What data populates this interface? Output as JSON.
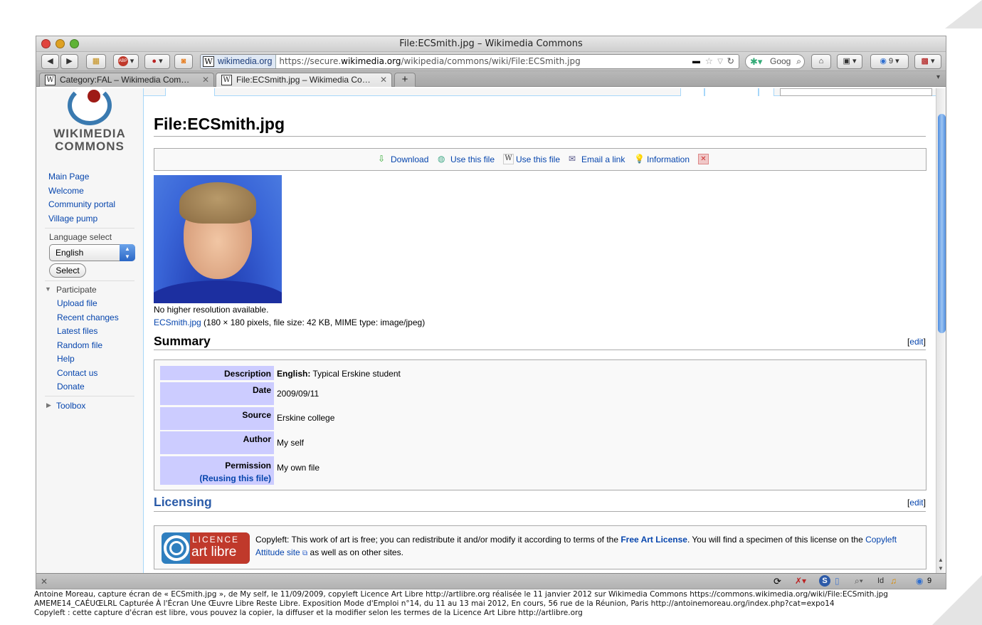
{
  "window": {
    "title": "File:ECSmith.jpg – Wikimedia Commons"
  },
  "navbar": {
    "site_badge": "wikimedia.org",
    "url_prefix": "https://secure.",
    "url_domain": "wikimedia.org",
    "url_path": "/wikipedia/commons/wiki/File:ECSmith.jpg",
    "search_placeholder": "Goog",
    "tab_count": "9"
  },
  "tabs": [
    {
      "label": "Category:FAL – Wikimedia Com…",
      "icon": "W"
    },
    {
      "label": "File:ECSmith.jpg – Wikimedia Co…",
      "icon": "W"
    }
  ],
  "sidebar": {
    "logo_line1": "WIKIMEDIA",
    "logo_line2": "COMMONS",
    "nav": [
      "Main Page",
      "Welcome",
      "Community portal",
      "Village pump"
    ],
    "language_heading": "Language select",
    "language_value": "English",
    "select_button": "Select",
    "participate_heading": "Participate",
    "participate": [
      "Upload file",
      "Recent changes",
      "Latest files",
      "Random file",
      "Help",
      "Contact us",
      "Donate"
    ],
    "toolbox_heading": "Toolbox"
  },
  "page": {
    "title": "File:ECSmith.jpg",
    "file_actions": [
      "Download",
      "Use this file",
      "Use this file",
      "Email a link",
      "Information"
    ],
    "no_higher_res": "No higher resolution available.",
    "file_link": "ECSmith.jpg",
    "file_meta": "(180 × 180 pixels, file size: 42 KB, MIME type: image/jpeg)",
    "summary_heading": "Summary",
    "edit_label": "edit",
    "info": {
      "description_label": "Description",
      "description_lang": "English:",
      "description_value": "Typical Erskine student",
      "date_label": "Date",
      "date_value": "2009/09/11",
      "source_label": "Source",
      "source_value": "Erskine college",
      "author_label": "Author",
      "author_value": "My self",
      "permission_label": "Permission",
      "permission_sub": "(Reusing this file)",
      "permission_value": "My own file"
    },
    "licensing_heading": "Licensing",
    "license_logo_top": "LICENCE",
    "license_logo_bottom": "art libre",
    "license_text_1": "Copyleft: This work of art is free; you can redistribute it and/or modify it according to terms of the ",
    "license_link_1": "Free Art License",
    "license_text_2": ". You will find a specimen of this license on the ",
    "license_link_2": "Copyleft Attitude site",
    "license_text_3": " as well as on other sites."
  },
  "statusbar": {
    "badge_count": "9",
    "id_label": "Id"
  },
  "caption": {
    "line1": "Antoine Moreau, capture écran de « ECSmith.jpg », de My self, le 11/09/2009, copyleft Licence Art Libre http://artlibre.org réalisée le 11 janvier 2012 sur Wikimedia Commons https://commons.wikimedia.org/wiki/File:ECSmith.jpg",
    "line2": "AMEME14_CAÉUŒLRL Capturée À l'Écran Une Œuvre Libre Reste Libre. Exposition Mode d'Emploi n°14, du 11 au 13 mai 2012, En cours, 56 rue de la Réunion, Paris http://antoinemoreau.org/index.php?cat=expo14",
    "line3": "Copyleft : cette capture d'écran est libre, vous pouvez la copier, la diffuser et la modifier selon les termes de la Licence Art Libre http://artlibre.org"
  },
  "colors": {
    "link": "#0645ad",
    "infobox_label_bg": "#ccccff",
    "license_red": "#c0392b",
    "license_blue": "#2f7fbf"
  }
}
